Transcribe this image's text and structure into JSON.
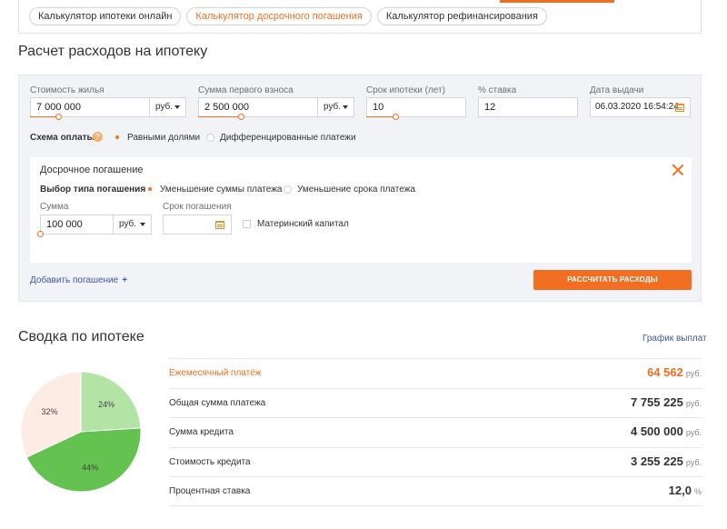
{
  "tabs": [
    {
      "label": "Калькулятор ипотеки онлайн",
      "active": false
    },
    {
      "label": "Калькулятор досрочного погашения",
      "active": true
    },
    {
      "label": "Калькулятор рефинансирования",
      "active": false
    }
  ],
  "calc": {
    "title": "Расчет расходов на ипотеку",
    "price_label": "Стоимость жилья",
    "price_value": "7 000 000",
    "price_currency": "руб.",
    "down_label": "Сумма первого взноса",
    "down_value": "2 500 000",
    "down_currency": "руб.",
    "term_label": "Срок ипотеки (лет)",
    "term_value": "10",
    "rate_label": "% ставка",
    "rate_value": "12",
    "date_label": "Дата выдачи",
    "date_value": "06.03.2020 16:54:24",
    "scheme_label": "Схема оплаты",
    "help_glyph": "?",
    "scheme_options": [
      "Равными долями",
      "Дифференцированные платежи"
    ],
    "early": {
      "title": "Досрочное погашение",
      "type_label": "Выбор типа погашения",
      "type_options": [
        "Уменьшение суммы платежа",
        "Уменьшение срока платежа"
      ],
      "sum_label": "Сумма",
      "sum_value": "100 000",
      "sum_currency": "руб.",
      "term_label": "Срок погашения",
      "term_value": "",
      "maternal_label": "Материнский капитал"
    },
    "add_label": "Добавить погашение",
    "add_plus": "+",
    "button_label": "РАССЧИТАТЬ РАСХОДЫ"
  },
  "summary": {
    "title": "Сводка по ипотеке",
    "schedule_link": "График выплат",
    "rows": [
      {
        "label": "Ежемесячный платёж",
        "value": "64 562",
        "unit": "руб.",
        "accent": true
      },
      {
        "label": "Общая сумма платежа",
        "value": "7 755 225",
        "unit": "руб.",
        "accent": false
      },
      {
        "label": "Сумма кредита",
        "value": "4 500 000",
        "unit": "руб.",
        "accent": false
      },
      {
        "label": "Стоимость кредита",
        "value": "3 255 225",
        "unit": "руб.",
        "accent": false
      },
      {
        "label": "Процентная ставка",
        "value": "12,0",
        "unit": "%",
        "accent": false
      }
    ]
  },
  "chart_data": {
    "type": "pie",
    "categories": [
      "",
      "",
      ""
    ],
    "values": [
      24,
      44,
      32
    ],
    "labels": [
      "24%",
      "44%",
      "32%"
    ],
    "colors": [
      "#b3e4a5",
      "#63c250",
      "#fdece4"
    ]
  },
  "colors": {
    "accent": "#f26f21",
    "link": "#3b5aa6"
  }
}
